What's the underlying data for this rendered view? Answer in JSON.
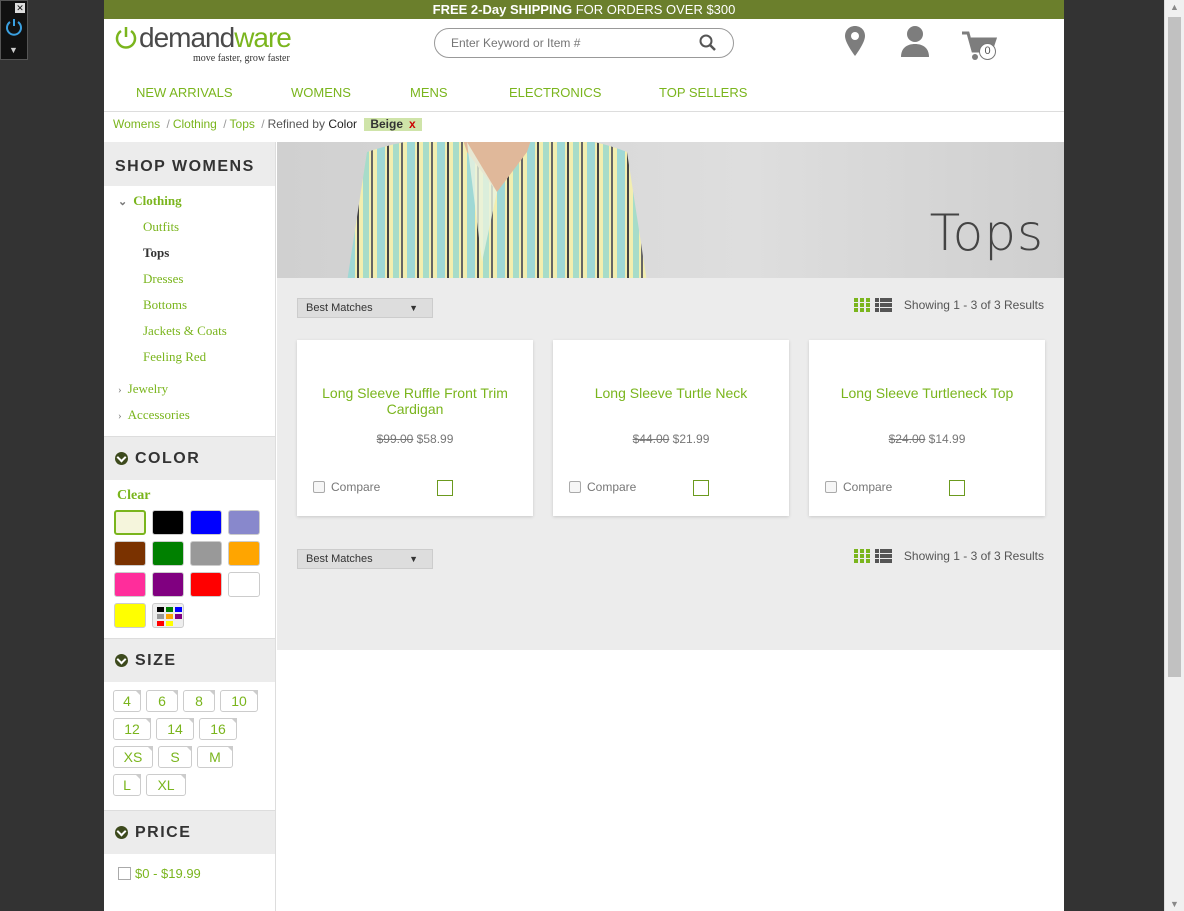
{
  "promo": {
    "free": "FREE",
    "days": "2-Day",
    "shipping": "SHIPPING",
    "rest": "FOR ORDERS OVER $300"
  },
  "logo": {
    "prefix": "demand",
    "suffix": "ware",
    "tagline": "move faster, grow faster"
  },
  "search": {
    "placeholder": "Enter Keyword or Item #"
  },
  "cart": {
    "count": "0"
  },
  "nav": [
    "NEW ARRIVALS",
    "WOMENS",
    "MENS",
    "ELECTRONICS",
    "TOP SELLERS"
  ],
  "breadcrumb": {
    "items": [
      "Womens",
      "Clothing",
      "Tops"
    ],
    "refined_by": "Refined by",
    "refine_attr": "Color",
    "refine_value": "Beige",
    "remove": "x"
  },
  "sidebar": {
    "title": "SHOP WOMENS",
    "clothing": "Clothing",
    "sub_items": [
      "Outfits",
      "Tops",
      "Dresses",
      "Bottoms",
      "Jackets & Coats",
      "Feeling Red"
    ],
    "active": "Tops",
    "other": [
      "Jewelry",
      "Accessories"
    ]
  },
  "refinements": {
    "color": {
      "title": "COLOR",
      "clear": "Clear",
      "swatches": [
        "#f5f5dc",
        "#000000",
        "#0000ff",
        "#8888cc",
        "#7a3200",
        "#008000",
        "#999999",
        "#ffa500",
        "#ff2d9b",
        "#800080",
        "#ff0000",
        "#ffffff",
        "#ffff00",
        "miscellaneous"
      ]
    },
    "size": {
      "title": "SIZE",
      "rows": [
        [
          "4",
          "6",
          "8",
          "10"
        ],
        [
          "12",
          "14",
          "16"
        ],
        [
          "XS",
          "S",
          "M"
        ],
        [
          "L",
          "XL"
        ]
      ]
    },
    "price": {
      "title": "PRICE",
      "options": [
        "$0 - $19.99"
      ]
    }
  },
  "banner": {
    "title": "Tops"
  },
  "sort": {
    "selected": "Best Matches"
  },
  "results_text": "Showing 1 - 3 of 3 Results",
  "products": [
    {
      "name": "Long Sleeve Ruffle Front Trim Cardigan",
      "list_price": "$99.00",
      "sale_price": "$58.99",
      "compare": "Compare"
    },
    {
      "name": "Long Sleeve Turtle Neck",
      "list_price": "$44.00",
      "sale_price": "$21.99",
      "compare": "Compare"
    },
    {
      "name": "Long Sleeve Turtleneck Top",
      "list_price": "$24.00",
      "sale_price": "$14.99",
      "compare": "Compare"
    }
  ],
  "colors": {
    "brand_green": "#7ab51d",
    "promo_bg": "#6b7f2c",
    "panel_bg": "#ececec"
  }
}
